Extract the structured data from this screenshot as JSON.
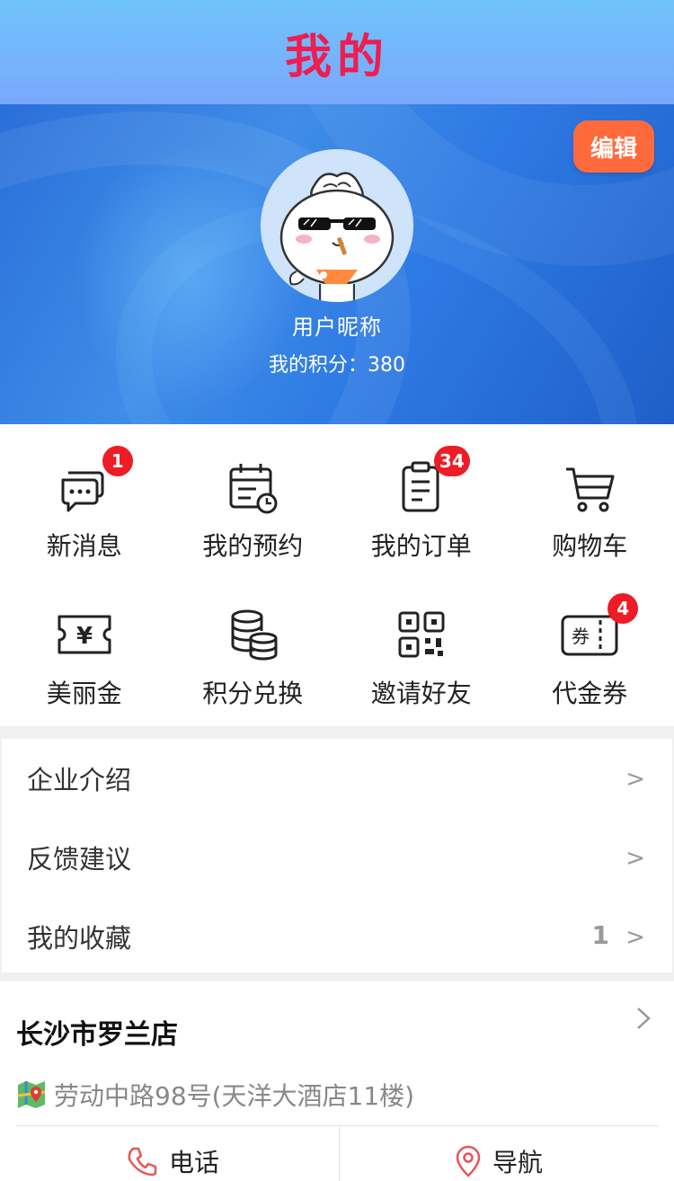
{
  "header": {
    "title": "我的"
  },
  "profile": {
    "edit_label": "编辑",
    "nickname": "用户昵称",
    "points_text": "我的积分：380"
  },
  "grid": [
    {
      "label": "新消息",
      "icon": "message-icon",
      "badge": "1"
    },
    {
      "label": "我的预约",
      "icon": "calendar-icon",
      "badge": null
    },
    {
      "label": "我的订单",
      "icon": "clipboard-icon",
      "badge": "34"
    },
    {
      "label": "购物车",
      "icon": "cart-icon",
      "badge": null
    },
    {
      "label": "美丽金",
      "icon": "yen-ticket-icon",
      "badge": null
    },
    {
      "label": "积分兑换",
      "icon": "coins-icon",
      "badge": null
    },
    {
      "label": "邀请好友",
      "icon": "qrcode-icon",
      "badge": null
    },
    {
      "label": "代金券",
      "icon": "coupon-icon",
      "badge": "4"
    }
  ],
  "coupon_icon_text": "券",
  "yen_icon_text": "¥",
  "menu": [
    {
      "label": "企业介绍",
      "count": "",
      "chevron": ">"
    },
    {
      "label": "反馈建议",
      "count": "",
      "chevron": ">"
    },
    {
      "label": "我的收藏",
      "count": "1",
      "chevron": ">"
    }
  ],
  "store": {
    "name": "长沙市罗兰店",
    "address": "劳动中路98号(天洋大酒店11楼)",
    "call_label": "电话",
    "nav_label": "导航"
  },
  "colors": {
    "title_red": "#ee1d52",
    "header_gradient": [
      "#6fc3fb",
      "#7aa8fb"
    ],
    "edit_orange": "#ff6a3d",
    "badge_red": "#ee1c25",
    "icon_red": "#e8555a"
  }
}
